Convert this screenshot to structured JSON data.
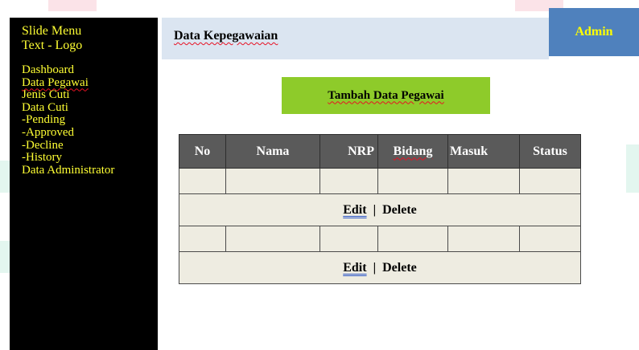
{
  "sidebar": {
    "title_line1": "Slide Menu",
    "title_line2": "Text - Logo",
    "items": [
      {
        "label": "Dashboard"
      },
      {
        "label": "Data Pegawai"
      },
      {
        "label": "Jenis Cuti"
      },
      {
        "label": "Data Cuti"
      },
      {
        "label": "-Pending"
      },
      {
        "label": "-Approved"
      },
      {
        "label": "-Decline"
      },
      {
        "label": "-History"
      },
      {
        "label": "Data Administrator"
      }
    ]
  },
  "header": {
    "title": "Data Kepegawaian",
    "user_label": "Admin"
  },
  "main": {
    "add_button_label": "Tambah Data Pegawai"
  },
  "table": {
    "headers": [
      "No",
      "Nama",
      "NRP",
      "Bidang",
      "Masuk",
      "Status"
    ],
    "rows": [
      {
        "actions": {
          "edit": "Edit",
          "separator": "|",
          "delete": "Delete"
        }
      },
      {
        "actions": {
          "edit": "Edit",
          "separator": "|",
          "delete": "Delete"
        }
      }
    ]
  },
  "colors": {
    "sidebar_bg": "#000000",
    "sidebar_text": "#ffff33",
    "header_bg": "#dbe5f1",
    "admin_bg": "#4f81bd",
    "admin_text": "#ffff00",
    "add_button_bg": "#8ecb2a",
    "table_header_bg": "#5a5a5a",
    "table_cell_bg": "#eeece1"
  }
}
